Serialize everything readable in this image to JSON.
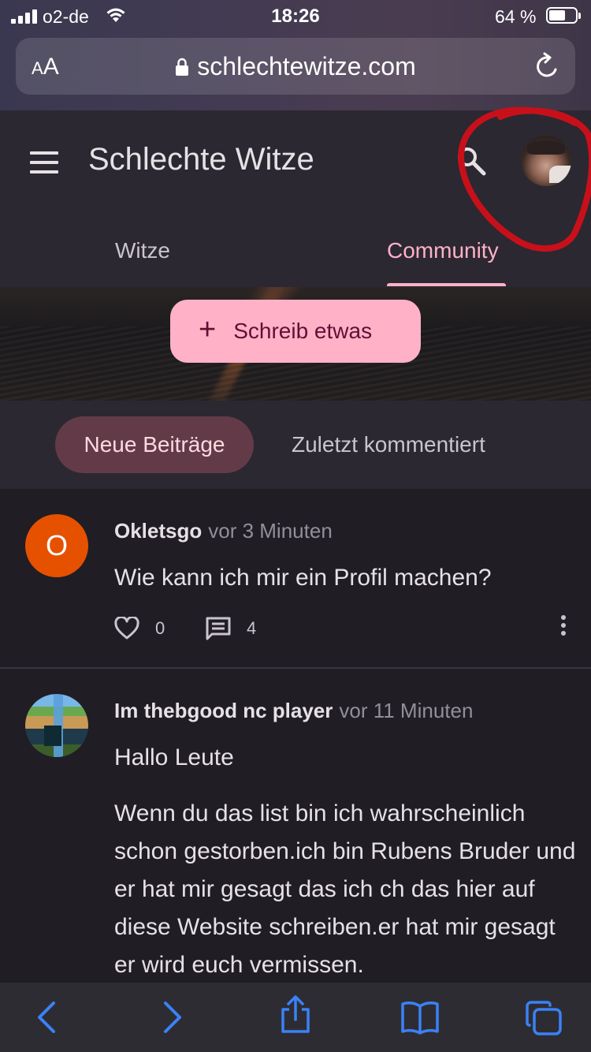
{
  "status_bar": {
    "carrier": "o2-de",
    "time": "18:26",
    "battery_percent": "64 %",
    "battery_level": 0.64
  },
  "browser": {
    "text_size_label_small": "A",
    "text_size_label_large": "A",
    "url": "schlechtewitze.com"
  },
  "app": {
    "title": "Schlechte Witze",
    "tabs": [
      {
        "label": "Witze",
        "active": false
      },
      {
        "label": "Community",
        "active": true
      }
    ],
    "compose_button": "Schreib etwas",
    "filters": [
      {
        "label": "Neue Beiträge",
        "selected": true
      },
      {
        "label": "Zuletzt kommentiert",
        "selected": false
      }
    ]
  },
  "posts": [
    {
      "avatar_letter": "O",
      "author": "Okletsgo",
      "time": "vor 3 Minuten",
      "title": "Wie kann ich mir ein Profil machen?",
      "likes": "0",
      "comments": "4"
    },
    {
      "author": "Im thebgood nc player",
      "time": "vor 11 Minuten",
      "title": "Hallo Leute",
      "body": "Wenn du das list bin ich wahrscheinlich schon gestorben.ich bin Rubens Bruder und er hat mir gesagt das ich ch das hier auf diese Website schreiben.er hat mir gesagt er wird euch vermissen."
    }
  ],
  "colors": {
    "accent_pink": "#ffb1c8",
    "chip_selected": "#633b48",
    "avatar_orange": "#e65100",
    "annotation_red": "#c8101a",
    "safari_blue": "#3a82f7"
  }
}
